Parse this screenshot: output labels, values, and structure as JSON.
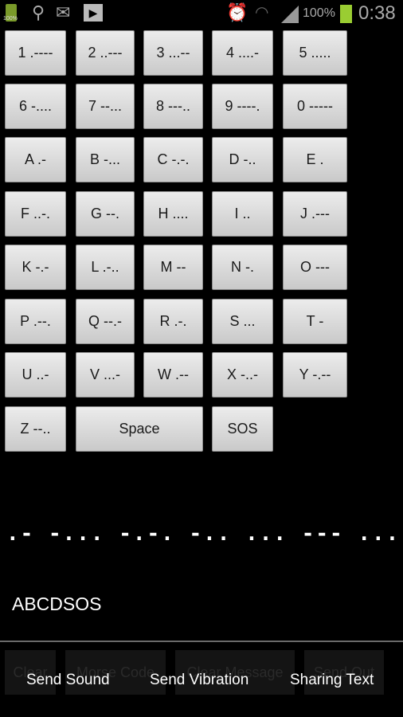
{
  "status_bar": {
    "left_icons": [
      "battery-small-icon",
      "usb-icon",
      "email-icon",
      "play-store-icon"
    ],
    "right_icons": [
      "alarm-icon",
      "wifi-icon",
      "signal-icon",
      "battery-icon"
    ],
    "battery_small_label": "100%",
    "battery_percent": "100%",
    "time": "0:38",
    "battery_color": "#9acd32"
  },
  "keys": [
    [
      "1 .----",
      "2 ..---",
      "3 ...--",
      "4 ....-",
      "5 ....."
    ],
    [
      "6 -....",
      "7 --...",
      "8 ---..",
      "9 ----.",
      "0 -----"
    ],
    [
      "A .-",
      "B -...",
      "C -.-.",
      "D -..",
      "E ."
    ],
    [
      "F ..-.",
      "G --.",
      "H ....",
      "I ..",
      "J .---"
    ],
    [
      "K -.-",
      "L .-..",
      "M --",
      "N -.",
      "O ---"
    ],
    [
      "P .--.",
      "Q --.-",
      "R .-.",
      "S ...",
      "T -"
    ],
    [
      "U ..-",
      "V ...-",
      "W .--",
      "X -..-",
      "Y -.--"
    ],
    [
      "Z --..",
      "Space",
      "SOS"
    ]
  ],
  "output": {
    "morse": ".- -... -.-. -.. ... --- ...",
    "text": "ABCDSOS"
  },
  "background_buttons": [
    "Clear",
    "Morse Code",
    "Clear Message",
    "Send Out"
  ],
  "menu": [
    "Send Sound",
    "Send Vibration",
    "Sharing Text"
  ]
}
